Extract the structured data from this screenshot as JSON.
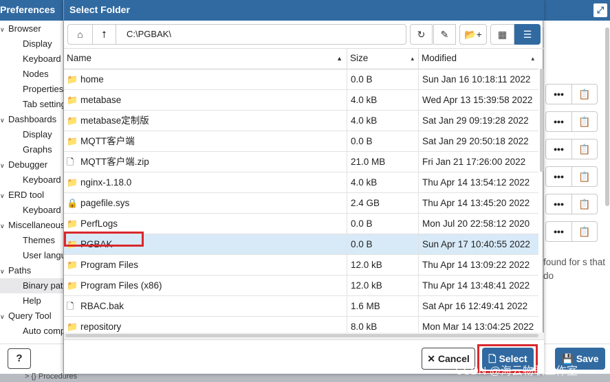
{
  "preferences": {
    "title": "Preferences",
    "tree": [
      {
        "label": "Browser",
        "level": 0,
        "expanded": true
      },
      {
        "label": "Display",
        "level": 1
      },
      {
        "label": "Keyboard",
        "level": 1
      },
      {
        "label": "Nodes",
        "level": 1
      },
      {
        "label": "Properties",
        "level": 1
      },
      {
        "label": "Tab setting",
        "level": 1
      },
      {
        "label": "Dashboards",
        "level": 0,
        "expanded": true
      },
      {
        "label": "Display",
        "level": 1
      },
      {
        "label": "Graphs",
        "level": 1
      },
      {
        "label": "Debugger",
        "level": 0,
        "expanded": true
      },
      {
        "label": "Keyboard",
        "level": 1
      },
      {
        "label": "ERD tool",
        "level": 0,
        "expanded": true
      },
      {
        "label": "Keyboard",
        "level": 1
      },
      {
        "label": "Miscellaneous",
        "level": 0,
        "expanded": true
      },
      {
        "label": "Themes",
        "level": 1
      },
      {
        "label": "User langu",
        "level": 1
      },
      {
        "label": "Paths",
        "level": 0,
        "expanded": true
      },
      {
        "label": "Binary path",
        "level": 1,
        "selected": true
      },
      {
        "label": "Help",
        "level": 1
      },
      {
        "label": "Query Tool",
        "level": 0,
        "expanded": true
      },
      {
        "label": "Auto comp",
        "level": 1
      }
    ],
    "found_text": "found for s that do",
    "help_label": "?",
    "save_label": "Save",
    "bottom_strip_text": "> {} Procedures"
  },
  "dialog": {
    "title": "Select Folder",
    "path": "C:\\PGBAK\\",
    "columns": {
      "name": "Name",
      "size": "Size",
      "modified": "Modified"
    },
    "files": [
      {
        "name": "home",
        "type": "folder",
        "size": "0.0 B",
        "modified": "Sun Jan 16 10:18:11 2022"
      },
      {
        "name": "metabase",
        "type": "folder",
        "size": "4.0 kB",
        "modified": "Wed Apr 13 15:39:58 2022"
      },
      {
        "name": "metabase定制版",
        "type": "folder",
        "size": "4.0 kB",
        "modified": "Sat Jan 29 09:19:28 2022"
      },
      {
        "name": "MQTT客户端",
        "type": "folder",
        "size": "0.0 B",
        "modified": "Sat Jan 29 20:50:18 2022"
      },
      {
        "name": "MQTT客户端.zip",
        "type": "file",
        "size": "21.0 MB",
        "modified": "Fri Jan 21 17:26:00 2022"
      },
      {
        "name": "nginx-1.18.0",
        "type": "folder",
        "size": "4.0 kB",
        "modified": "Thu Apr 14 13:54:12 2022"
      },
      {
        "name": "pagefile.sys",
        "type": "locked-file",
        "size": "2.4 GB",
        "modified": "Thu Apr 14 13:45:20 2022"
      },
      {
        "name": "PerfLogs",
        "type": "folder",
        "size": "0.0 B",
        "modified": "Mon Jul 20 22:58:12 2020"
      },
      {
        "name": "PGBAK",
        "type": "folder",
        "size": "0.0 B",
        "modified": "Sun Apr 17 10:40:55 2022",
        "selected": true
      },
      {
        "name": "Program Files",
        "type": "folder",
        "size": "12.0 kB",
        "modified": "Thu Apr 14 13:09:22 2022"
      },
      {
        "name": "Program Files (x86)",
        "type": "folder",
        "size": "12.0 kB",
        "modified": "Thu Apr 14 13:48:41 2022"
      },
      {
        "name": "RBAC.bak",
        "type": "file",
        "size": "1.6 MB",
        "modified": "Sat Apr 16 12:49:41 2022"
      },
      {
        "name": "repository",
        "type": "folder",
        "size": "8.0 kB",
        "modified": "Mon Mar 14 13:04:25 2022"
      }
    ],
    "cancel_label": "Cancel",
    "select_label": "Select"
  },
  "watermark": "CSDN @海云物联工作室",
  "colors": {
    "accent": "#316aa1",
    "selected_row": "#d8eaf8",
    "annotation": "#d8282d"
  }
}
